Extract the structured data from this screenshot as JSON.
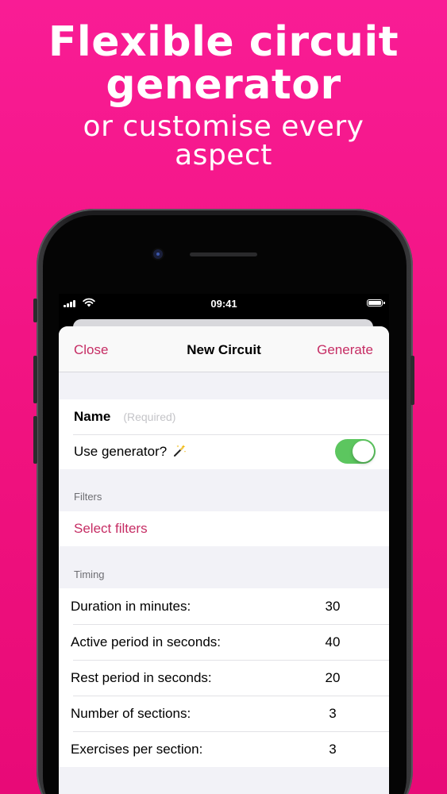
{
  "headline": {
    "line1": "Flexible circuit",
    "line2": "generator",
    "line3": "or customise every",
    "line4": "aspect"
  },
  "status_bar": {
    "time": "09:41"
  },
  "nav": {
    "close_label": "Close",
    "title": "New Circuit",
    "generate_label": "Generate"
  },
  "form": {
    "name_label": "Name",
    "name_placeholder": "(Required)",
    "name_value": "",
    "generator_label": "Use generator?",
    "generator_icon": "magic-wand-icon",
    "generator_on": true
  },
  "filters": {
    "header": "Filters",
    "select_label": "Select filters"
  },
  "timing": {
    "header": "Timing",
    "rows": [
      {
        "label": "Duration in minutes:",
        "value": "30"
      },
      {
        "label": "Active period in seconds:",
        "value": "40"
      },
      {
        "label": "Rest period in seconds:",
        "value": "20"
      },
      {
        "label": "Number of sections:",
        "value": "3"
      },
      {
        "label": "Exercises per section:",
        "value": "3"
      }
    ]
  },
  "colors": {
    "background": "#f0127f",
    "accent": "#c62d64",
    "toggle_on": "#5cc65f"
  }
}
